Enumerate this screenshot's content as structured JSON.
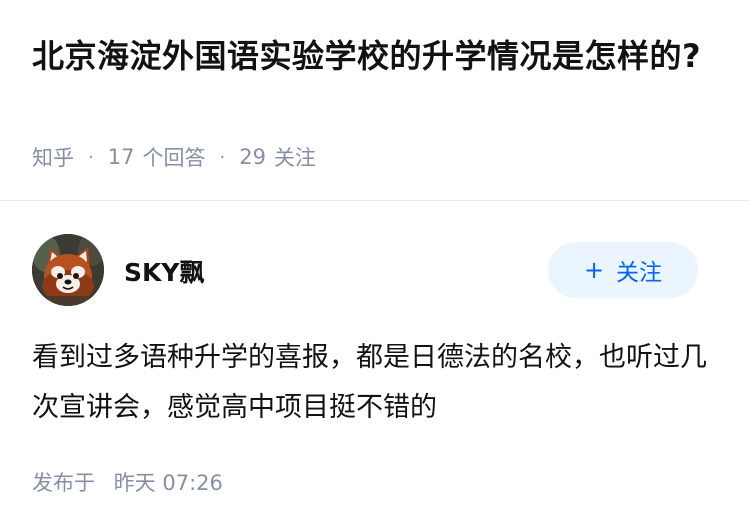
{
  "question": {
    "title": "北京海淀外国语实验学校的升学情况是怎样的?",
    "source": "知乎",
    "answer_count": "17",
    "answer_label": "个回答",
    "follow_count": "29",
    "follow_label": "关注"
  },
  "answer": {
    "author": {
      "name": "SKY飘",
      "avatar_icon": "red-panda-avatar"
    },
    "follow_button": {
      "icon": "+",
      "label": "关注"
    },
    "content": "看到过多语种升学的喜报，都是日德法的名校，也听过几次宣讲会，感觉高中项目挺不错的",
    "published_prefix": "发布于",
    "published_time": "昨天 07:26"
  },
  "colors": {
    "accent": "#0066ff",
    "follow_bg": "#ebf5ff",
    "muted_text": "#8590a6",
    "primary_text": "#121212",
    "divider": "#ebebeb"
  }
}
